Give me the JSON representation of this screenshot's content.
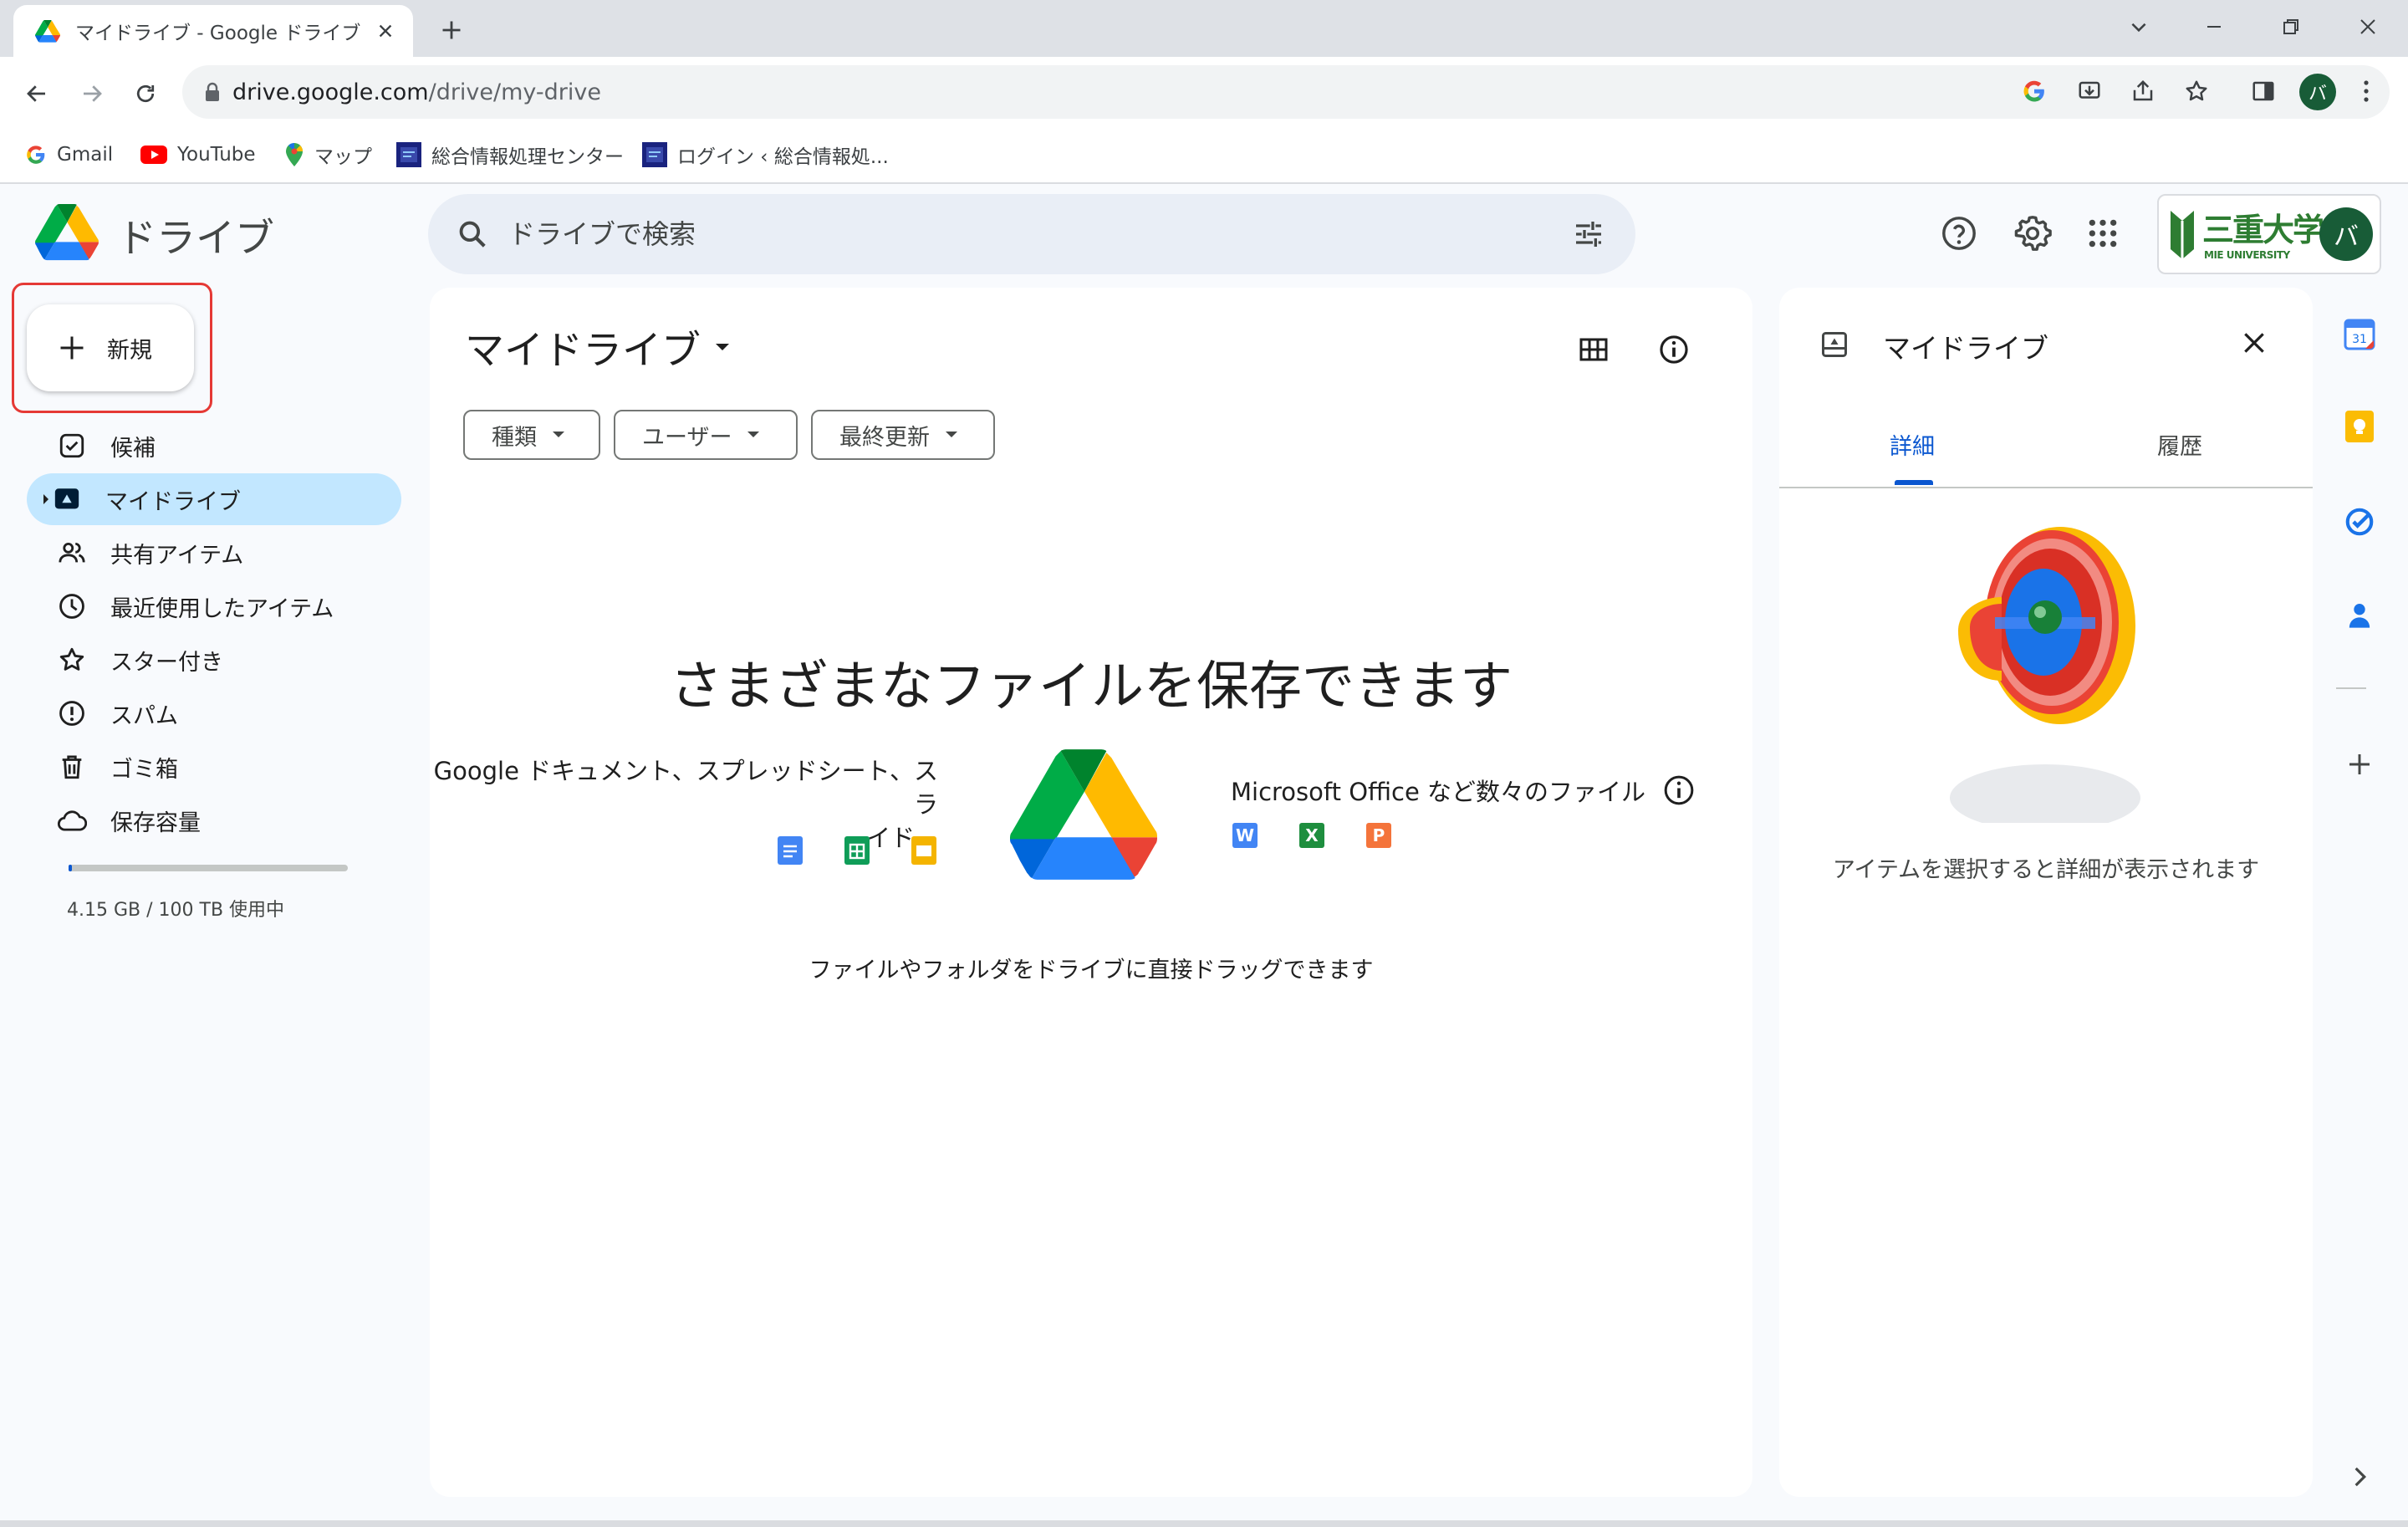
{
  "browser": {
    "tab_title": "マイドライブ - Google ドライブ",
    "url_host": "drive.google.com",
    "url_path": "/drive/my-drive",
    "profile_initial": "バ",
    "bookmarks": [
      {
        "label": "Gmail"
      },
      {
        "label": "YouTube"
      },
      {
        "label": "マップ"
      },
      {
        "label": "総合情報処理センター"
      },
      {
        "label": "ログイン ‹ 総合情報処..."
      }
    ]
  },
  "drive": {
    "app_name": "ドライブ",
    "search_placeholder": "ドライブで検索",
    "org_logo_main": "三重大学",
    "org_logo_sub": "MIE UNIVERSITY",
    "account_initial": "バ",
    "new_button": "新規",
    "nav": [
      {
        "label": "候補",
        "icon": "suggested-icon"
      },
      {
        "label": "マイドライブ",
        "icon": "my-drive-icon",
        "active": true
      },
      {
        "label": "共有アイテム",
        "icon": "shared-icon"
      },
      {
        "label": "最近使用したアイテム",
        "icon": "clock-icon"
      },
      {
        "label": "スター付き",
        "icon": "star-icon"
      },
      {
        "label": "スパム",
        "icon": "spam-icon"
      },
      {
        "label": "ゴミ箱",
        "icon": "trash-icon"
      },
      {
        "label": "保存容量",
        "icon": "cloud-icon"
      }
    ],
    "storage_text": "4.15 GB / 100 TB 使用中",
    "storage_used_fraction": 4e-05
  },
  "main": {
    "title": "マイドライブ",
    "filters": [
      {
        "label": "種類"
      },
      {
        "label": "ユーザー"
      },
      {
        "label": "最終更新"
      }
    ],
    "empty_title": "さまざまなファイルを保存できます",
    "google_text_line1": "Google ドキュメント、スプレッドシート、スラ",
    "google_text_line2": "イド、",
    "ms_text": "Microsoft Office など数々のファイル",
    "ms_badges": {
      "word": "W",
      "excel": "X",
      "powerpoint": "P"
    },
    "drag_text": "ファイルやフォルダをドライブに直接ドラッグできます"
  },
  "panel": {
    "title": "マイドライブ",
    "tabs": [
      {
        "label": "詳細",
        "active": true
      },
      {
        "label": "履歴",
        "active": false
      }
    ],
    "empty_message": "アイテムを選択すると詳細が表示されます"
  },
  "rail": {
    "calendar_day": "31"
  },
  "colors": {
    "accent": "#0b57d0",
    "active_nav_bg": "#c2e7ff",
    "highlight_box": "#e53935",
    "search_bg": "#e9eef6"
  }
}
